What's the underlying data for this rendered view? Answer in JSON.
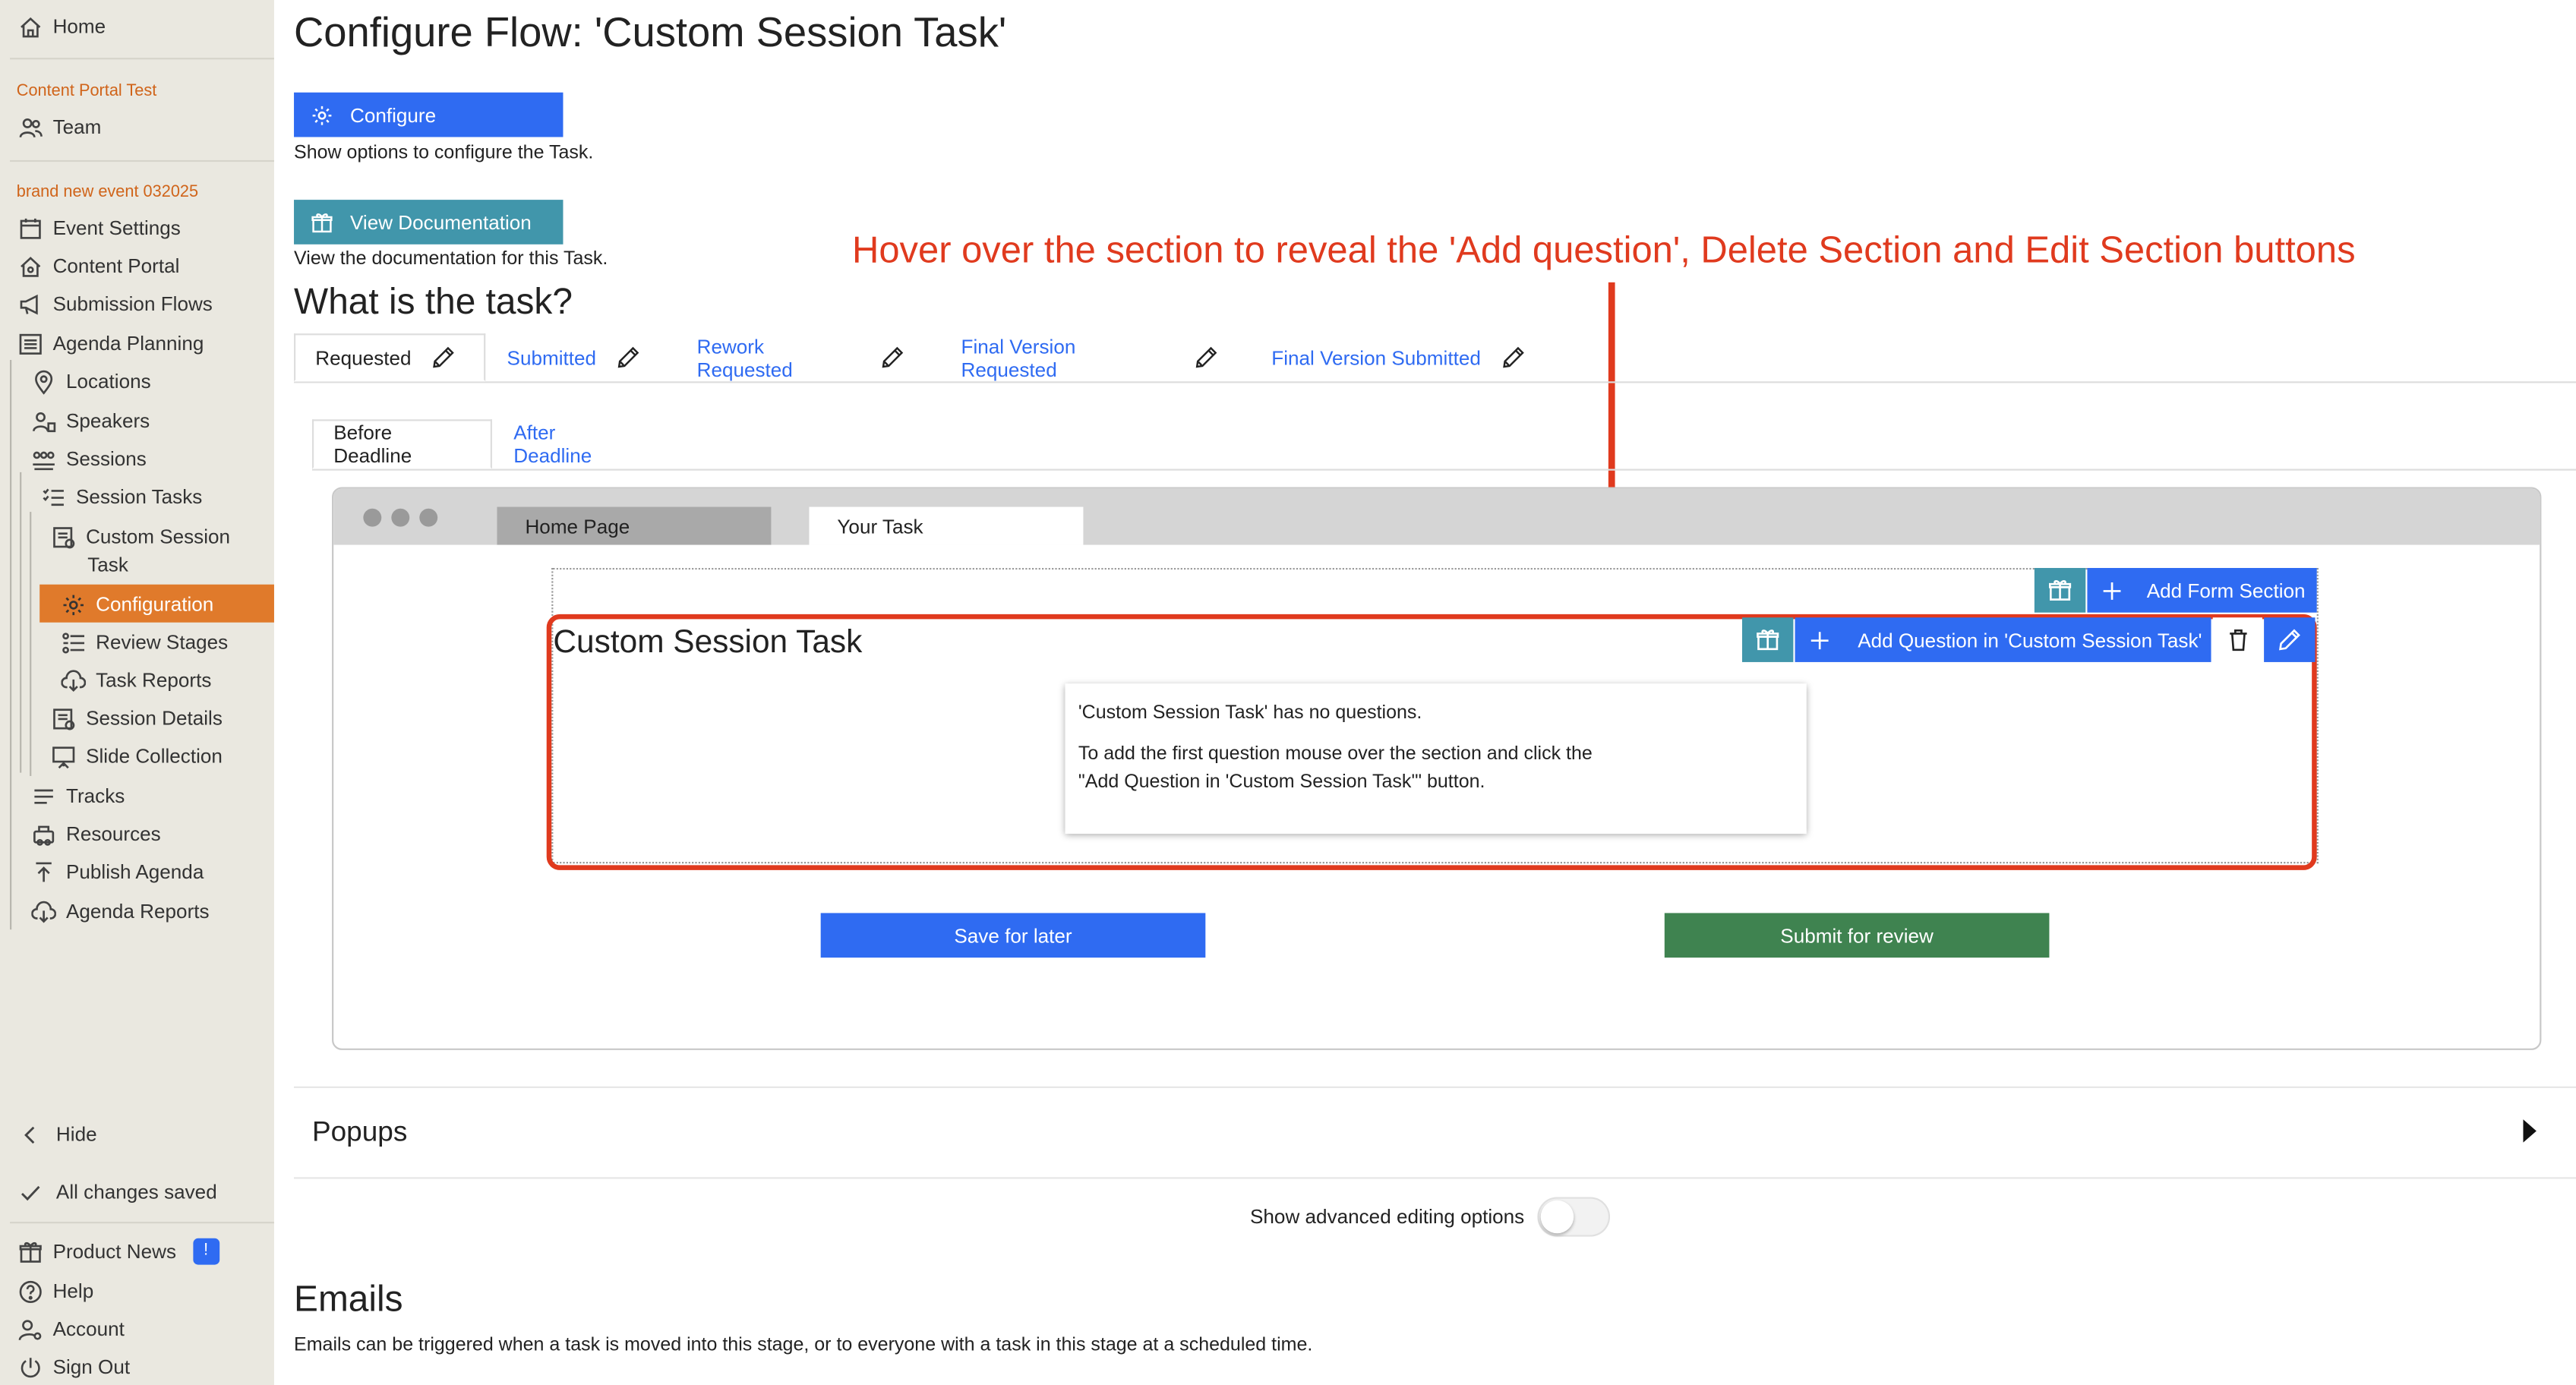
{
  "sidebar": {
    "home": "Home",
    "group1": "Content Portal Test",
    "team": "Team",
    "group2": "brand new event 032025",
    "items": [
      "Event Settings",
      "Content Portal",
      "Submission Flows",
      "Agenda Planning",
      "Locations",
      "Speakers",
      "Sessions",
      "Session Tasks",
      "Custom Session",
      "Task",
      "Configuration",
      "Review Stages",
      "Task Reports",
      "Session Details",
      "Slide Collection",
      "Tracks",
      "Resources",
      "Publish Agenda",
      "Agenda Reports"
    ],
    "hide": "Hide",
    "saved": "All changes saved",
    "product_news": "Product News",
    "product_news_badge": "!",
    "help": "Help",
    "account": "Account",
    "sign_out": "Sign Out"
  },
  "header": {
    "title": "Configure Flow: 'Custom Session Task'",
    "configure_label": "Configure",
    "configure_note": "Show options to configure the Task.",
    "docs_label": "View Documentation",
    "docs_note": "View the documentation for this Task."
  },
  "annotation": "Hover over the section to reveal the 'Add question', Delete Section and Edit Section buttons",
  "task_heading": "What is the task?",
  "stage_tabs": [
    "Requested",
    "Submitted",
    "Rework Requested",
    "Final Version Requested",
    "Final Version Submitted"
  ],
  "deadline_tabs": [
    "Before Deadline",
    "After Deadline"
  ],
  "preview": {
    "tabs": [
      "Home Page",
      "Your Task"
    ],
    "add_form_section": "Add Form Section",
    "section_title": "Custom Session Task",
    "add_question": "Add Question in 'Custom Session Task'",
    "info_line1": "'Custom Session Task' has no questions.",
    "info_line2": "To add the first question mouse over the section and click the",
    "info_line3": "\"Add Question in 'Custom Session Task'\" button.",
    "save_label": "Save for later",
    "submit_label": "Submit for review"
  },
  "popups": "Popups",
  "advanced": {
    "label": "Show advanced editing options",
    "enabled": false
  },
  "emails": {
    "heading": "Emails",
    "text": "Emails can be triggered when a task is moved into this stage, or to everyone with a task in this stage at a scheduled time."
  },
  "colors": {
    "accent_blue": "#2f6bf2",
    "teal": "#4196ab",
    "active_orange": "#e07a2b",
    "annotation_red": "#e03a1e",
    "submit_green": "#3f8350"
  }
}
